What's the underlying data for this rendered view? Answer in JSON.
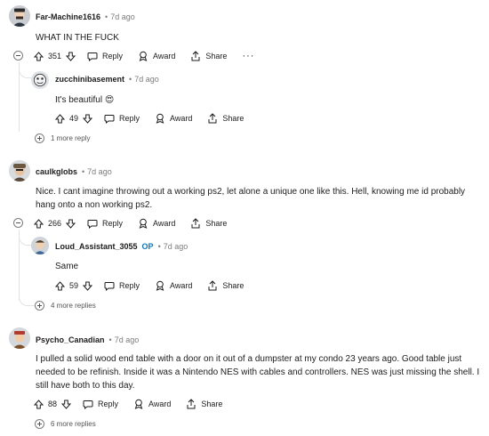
{
  "comments": [
    {
      "author": "Far-Machine1616",
      "time": "7d ago",
      "body": "WHAT IN THE FUCK",
      "score": "351",
      "reply_label": "Reply",
      "award_label": "Award",
      "share_label": "Share",
      "more_label": "···",
      "reply": {
        "author": "zucchinibasement",
        "time": "7d ago",
        "body": "It's beautiful",
        "emoji": "😍",
        "score": "49",
        "reply_label": "Reply",
        "award_label": "Award",
        "share_label": "Share"
      },
      "more_replies": "1 more reply"
    },
    {
      "author": "caulkglobs",
      "time": "7d ago",
      "body_line1": "Nice. I cant imagine throwing out a working ps2, let alone a unique one like this. Hell, knowing me id probably",
      "body_line2": "hang onto a non working ps2.",
      "score": "266",
      "reply_label": "Reply",
      "award_label": "Award",
      "share_label": "Share",
      "reply": {
        "author": "Loud_Assistant_3055",
        "op_badge": "OP",
        "time": "7d ago",
        "body": "Same",
        "score": "59",
        "reply_label": "Reply",
        "award_label": "Award",
        "share_label": "Share"
      },
      "more_replies": "4 more replies"
    },
    {
      "author": "Psycho_Canadian",
      "time": "7d ago",
      "body_line1": "I pulled a solid wood end table with a door on it out of a dumpster at my condo 23 years ago. Good table just",
      "body_line2": "needed to be refinish. Inside it was a Nintendo NES with cables and controllers. NES was just missing the shell. I",
      "body_line3": "still have both to this day.",
      "score": "88",
      "reply_label": "Reply",
      "award_label": "Award",
      "share_label": "Share",
      "more_replies": "6 more replies"
    }
  ],
  "dot_separator": "•",
  "colors": {
    "op": "#0079d3",
    "meta": "#7c7c7c",
    "thread_line": "#e0e4e8"
  }
}
